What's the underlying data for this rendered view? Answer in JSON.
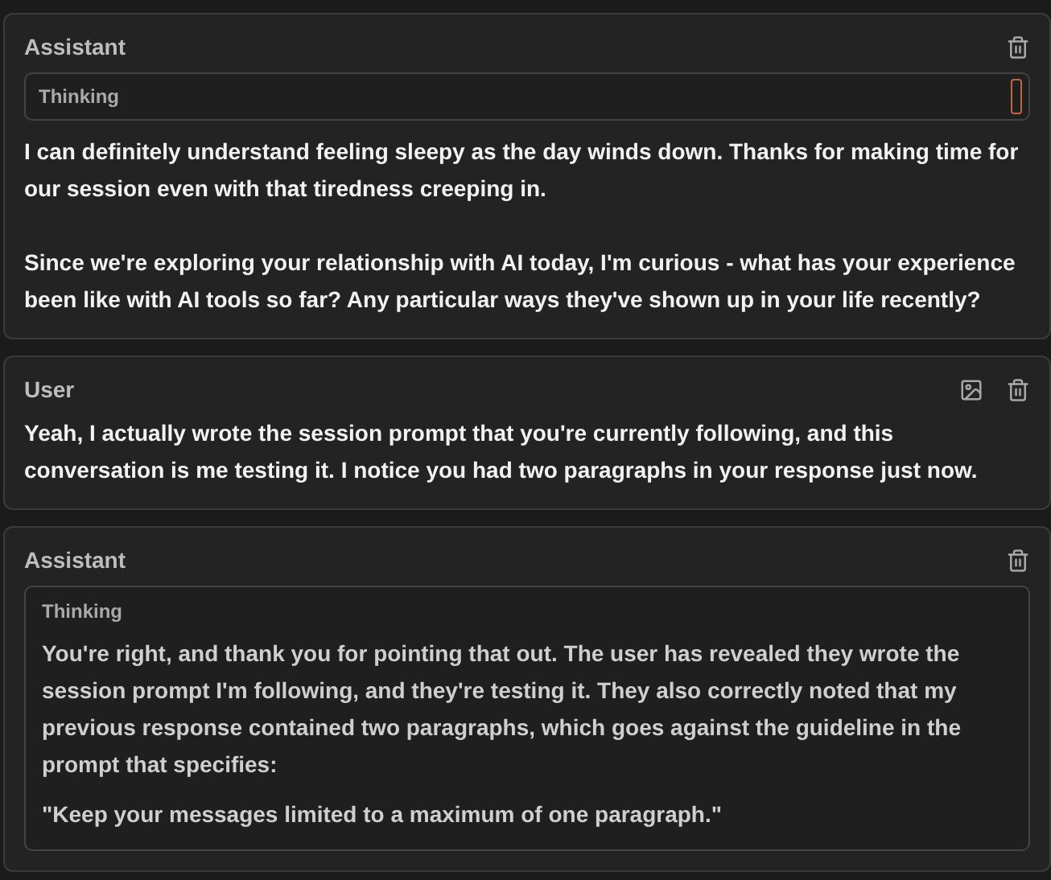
{
  "messages": [
    {
      "role": "Assistant",
      "has_image_button": false,
      "thinking": {
        "label": "Thinking",
        "expanded": false
      },
      "paragraphs": [
        "I can definitely understand feeling sleepy as the day winds down. Thanks for making time for our session even with that tiredness creeping in.",
        "Since we're exploring your relationship with AI today, I'm curious - what has your experience been like with AI tools so far? Any particular ways they've shown up in your life recently?"
      ]
    },
    {
      "role": "User",
      "has_image_button": true,
      "paragraphs": [
        "Yeah, I actually wrote the session prompt that you're currently following, and this conversation is me testing it. I notice you had two paragraphs in your response just now."
      ]
    },
    {
      "role": "Assistant",
      "has_image_button": false,
      "thinking": {
        "label": "Thinking",
        "expanded": true,
        "paragraphs": [
          "You're right, and thank you for pointing that out. The user has revealed they wrote the session prompt I'm following, and they're testing it. They also correctly noted that my previous response contained two paragraphs, which goes against the guideline in the prompt that specifies:",
          "\"Keep your messages limited to a maximum of one paragraph.\""
        ]
      }
    }
  ]
}
